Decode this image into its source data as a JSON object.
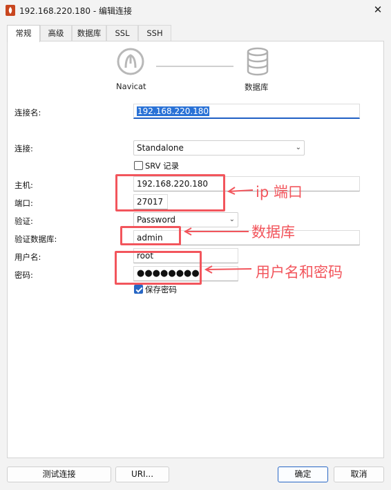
{
  "window": {
    "title": "192.168.220.180 - 编辑连接",
    "close_glyph": "✕"
  },
  "tabs": [
    {
      "label": "常规",
      "active": true
    },
    {
      "label": "高级",
      "active": false
    },
    {
      "label": "数据库",
      "active": false
    },
    {
      "label": "SSL",
      "active": false
    },
    {
      "label": "SSH",
      "active": false
    }
  ],
  "hero": {
    "left_label": "Navicat",
    "right_label": "数据库"
  },
  "form": {
    "connection_name": {
      "label": "连接名:",
      "value": "192.168.220.180"
    },
    "connection": {
      "label": "连接:",
      "value": "Standalone"
    },
    "srv_record": {
      "label": "SRV 记录",
      "checked": false
    },
    "host": {
      "label": "主机:",
      "value": "192.168.220.180"
    },
    "port": {
      "label": "端口:",
      "value": "27017"
    },
    "auth": {
      "label": "验证:",
      "value": "Password"
    },
    "auth_db": {
      "label": "验证数据库:",
      "value": "admin"
    },
    "username": {
      "label": "用户名:",
      "value": "root"
    },
    "password": {
      "label": "密码:",
      "value": "●●●●●●●●"
    },
    "save_password": {
      "label": "保存密码",
      "checked": true
    }
  },
  "annotations": {
    "ip_port": "ip 端口",
    "database": "数据库",
    "user_pass": "用户名和密码",
    "color": "#f2555c"
  },
  "buttons": {
    "test": "测试连接",
    "uri": "URI...",
    "ok": "确定",
    "cancel": "取消"
  }
}
